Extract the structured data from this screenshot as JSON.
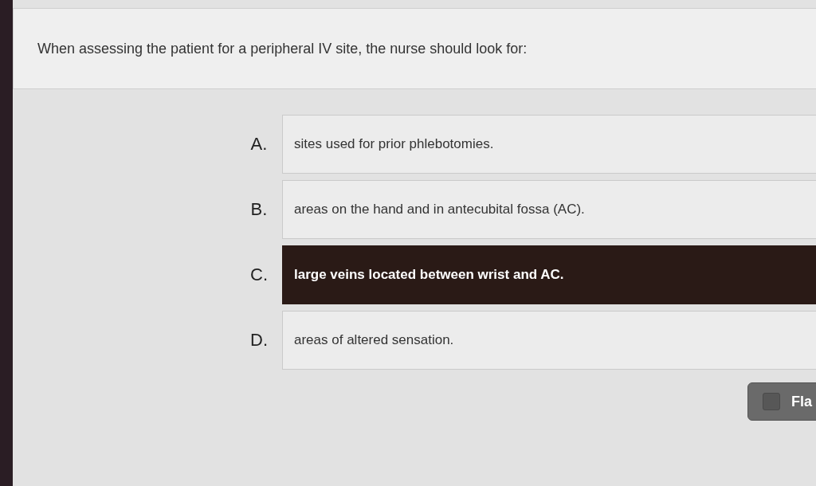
{
  "question": {
    "text": "When assessing the patient for a peripheral IV site, the nurse should look for:"
  },
  "options": [
    {
      "letter": "A.",
      "text": "sites used for prior phlebotomies.",
      "selected": false
    },
    {
      "letter": "B.",
      "text": "areas on the hand and in antecubital fossa (AC).",
      "selected": false
    },
    {
      "letter": "C.",
      "text": "large veins located between wrist and AC.",
      "selected": true
    },
    {
      "letter": "D.",
      "text": "areas of altered sensation.",
      "selected": false
    }
  ],
  "flag_button": {
    "label": "Fla",
    "checked": false
  }
}
